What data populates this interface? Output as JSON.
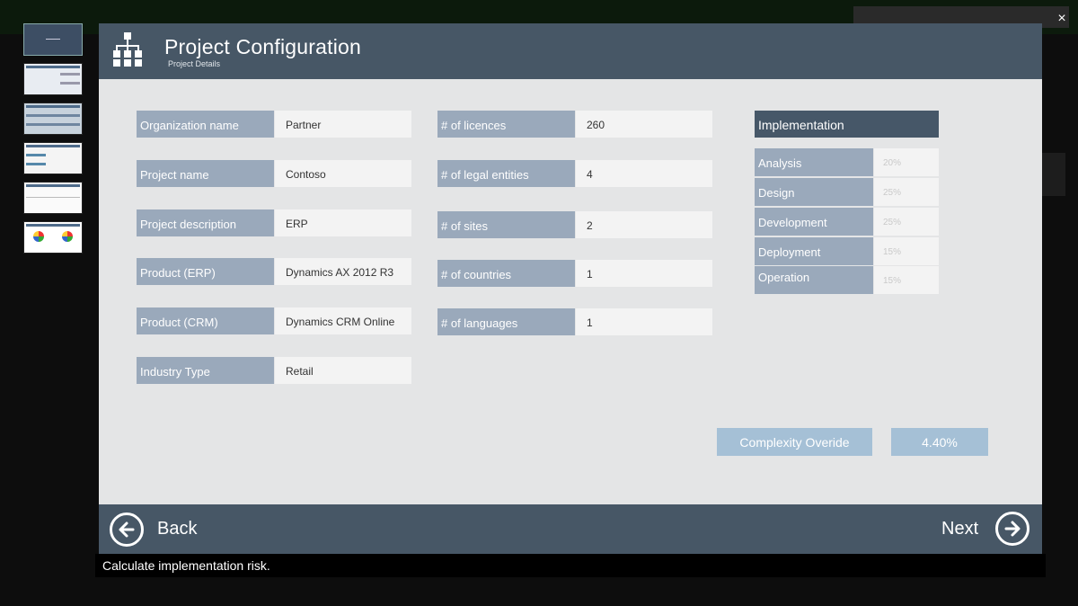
{
  "dialog": {
    "title": "Project Configuration",
    "subtitle": "Project Details"
  },
  "left_fields": [
    {
      "label": "Organization name",
      "value": "Partner"
    },
    {
      "label": "Project name",
      "value": "Contoso"
    },
    {
      "label": "Project description",
      "value": "ERP"
    },
    {
      "label": "Product (ERP)",
      "value": "Dynamics AX 2012 R3"
    },
    {
      "label": "Product (CRM)",
      "value": "Dynamics CRM Online"
    },
    {
      "label": "Industry Type",
      "value": "Retail"
    }
  ],
  "mid_fields": [
    {
      "label": "# of licences",
      "value": "260"
    },
    {
      "label": "# of legal entities",
      "value": "4"
    },
    {
      "label": "# of sites",
      "value": "2"
    },
    {
      "label": "# of countries",
      "value": "1"
    },
    {
      "label": "# of languages",
      "value": "1"
    }
  ],
  "implementation": {
    "header": "Implementation",
    "rows": [
      {
        "label": "Analysis",
        "value": "20%"
      },
      {
        "label": "Design",
        "value": "25%"
      },
      {
        "label": "Development",
        "value": "25%"
      },
      {
        "label": "Deployment",
        "value": "15%"
      },
      {
        "label": "Operation",
        "value": "15%"
      }
    ]
  },
  "complexity": {
    "label": "Complexity Overide",
    "value": "4.40%"
  },
  "footer": {
    "back_label": "Back",
    "next_label": "Next"
  },
  "status": "Calculate implementation risk.",
  "close_glyph": "×",
  "colors": {
    "header": "#475766",
    "label_bg": "#9aa9bb",
    "accent": "#a5c0d6",
    "body": "#e4e5e6"
  },
  "icons": [
    "hierarchy-icon",
    "arrow-left-icon",
    "arrow-right-icon",
    "close-icon"
  ]
}
